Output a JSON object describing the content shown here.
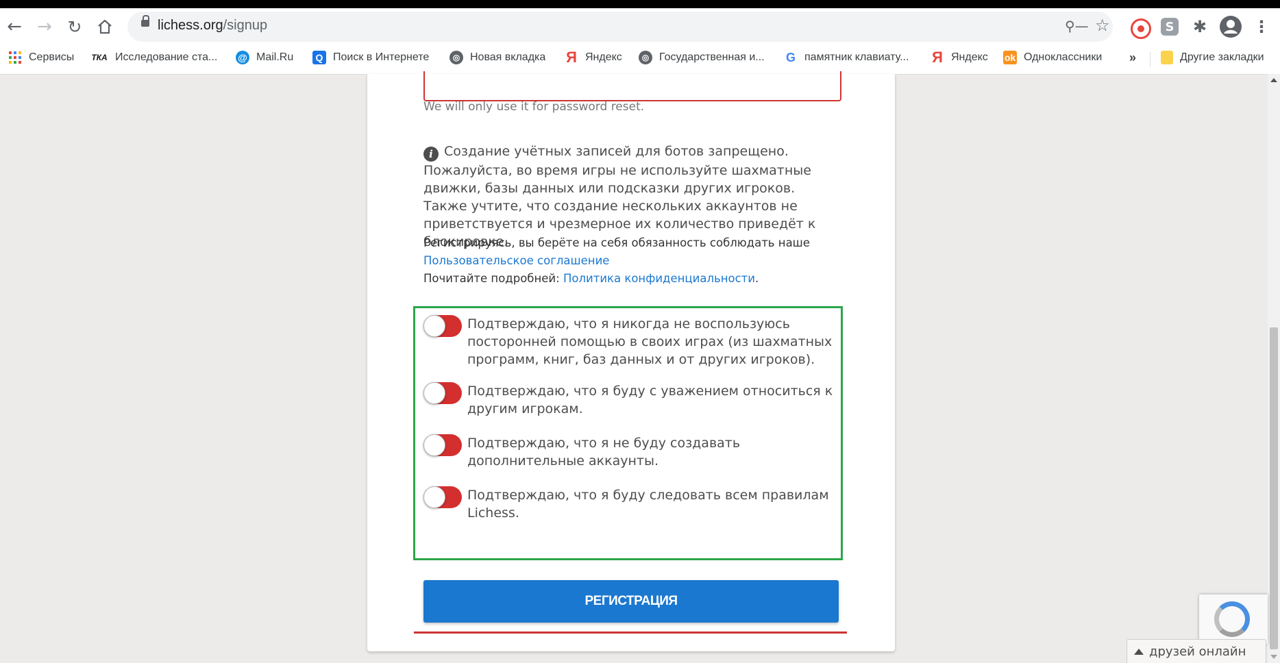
{
  "browser": {
    "url_host": "lichess.org",
    "url_path": "/signup",
    "extension_badges": [
      "S"
    ]
  },
  "bookmarks": [
    {
      "label": "Сервисы",
      "icon": "apps-grid-icon"
    },
    {
      "label": "Исследование ста...",
      "icon": "tka-icon"
    },
    {
      "label": "Mail.Ru",
      "icon": "mailru-icon"
    },
    {
      "label": "Поиск в Интернете",
      "icon": "search-icon"
    },
    {
      "label": "Новая вкладка",
      "icon": "globe-icon"
    },
    {
      "label": "Яндекс",
      "icon": "yandex-icon"
    },
    {
      "label": "Государственная и...",
      "icon": "globe-icon"
    },
    {
      "label": "памятник клавиату...",
      "icon": "google-icon"
    },
    {
      "label": "Яндекс",
      "icon": "yandex-icon"
    },
    {
      "label": "Одноклассники",
      "icon": "odnoklassniki-icon"
    }
  ],
  "bookmarks_more": "»",
  "other_bookmarks": "Другие закладки",
  "form": {
    "email_help": "We will only use it for password reset.",
    "warning_text": "Создание учётных записей для ботов запрещено. Пожалуйста, во время игры не используйте шахматные движки, базы данных или подсказки других игроков. Также учтите, что создание нескольких аккаунтов не приветствуется и чрезмерное их количество приведёт к блокировке.",
    "terms_prefix": "Регистрируясь, вы берёте на себя обязанность соблюдать наше",
    "terms_link": "Пользовательское соглашение",
    "privacy_prefix": "Почитайте подробней:",
    "privacy_link": "Политика конфиденциальности",
    "privacy_suffix": ".",
    "agreements": [
      {
        "text": "Подтверждаю, что я никогда не воспользуюсь посторонней помощью в своих играх (из шахматных программ, книг, баз данных и от других игроков)."
      },
      {
        "text": "Подтверждаю, что я буду с уважением относиться к другим игрокам."
      },
      {
        "text": "Подтверждаю, что я не буду создавать дополнительные аккаунты."
      },
      {
        "text": "Подтверждаю, что я буду следовать всем правилам Lichess."
      }
    ],
    "submit_label": "РЕГИСТРАЦИЯ"
  },
  "friends_label": "друзей онлайн",
  "colors": {
    "toggle_off": "#d32f2f",
    "highlight_frame": "#2aa64a",
    "submit": "#1b78d0",
    "link": "#1b78d0",
    "error": "#cc3333"
  }
}
